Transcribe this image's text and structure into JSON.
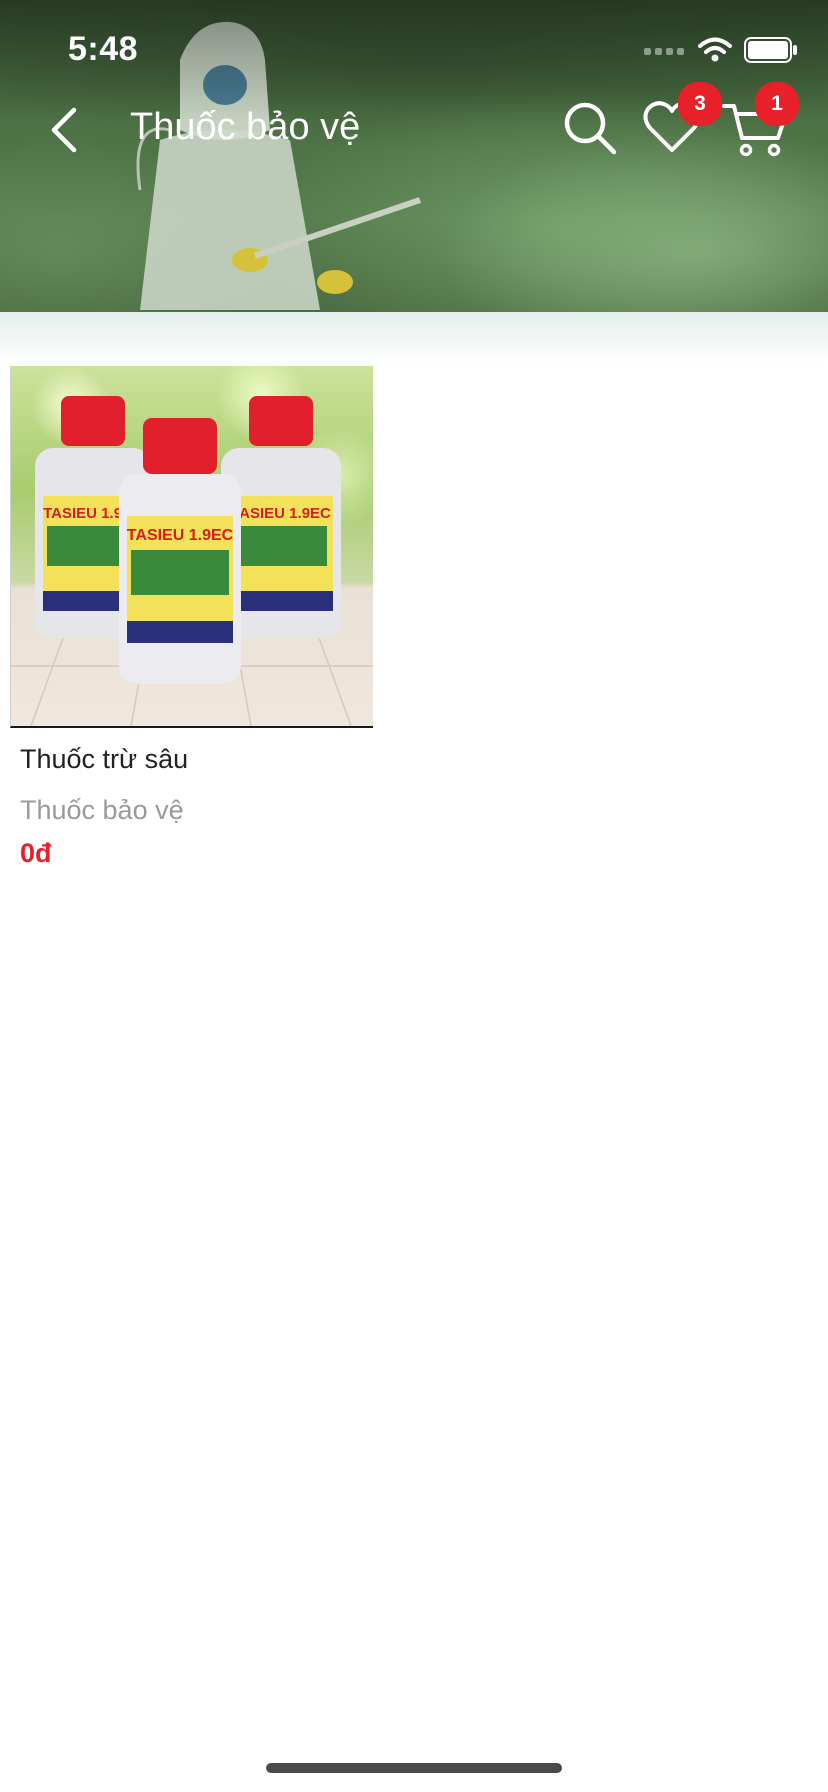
{
  "status_bar": {
    "time": "5:48",
    "icons": [
      "signal-icon",
      "wifi-icon",
      "battery-icon"
    ]
  },
  "nav": {
    "back_icon": "chevron-left-icon",
    "title": "Thuốc bảo vệ",
    "search_icon": "search-icon",
    "wishlist_icon": "heart-icon",
    "wishlist_count": "3",
    "cart_icon": "cart-icon",
    "cart_count": "1"
  },
  "colors": {
    "accent": "#e8202a",
    "header_green": "#4d7245",
    "text_primary": "#222222",
    "text_secondary": "#9a9a9a"
  },
  "products": [
    {
      "name": "Thuốc trừ sâu",
      "category": "Thuốc bảo vệ",
      "price": "0đ",
      "image_label": "TASIEU 1.9EC"
    }
  ]
}
